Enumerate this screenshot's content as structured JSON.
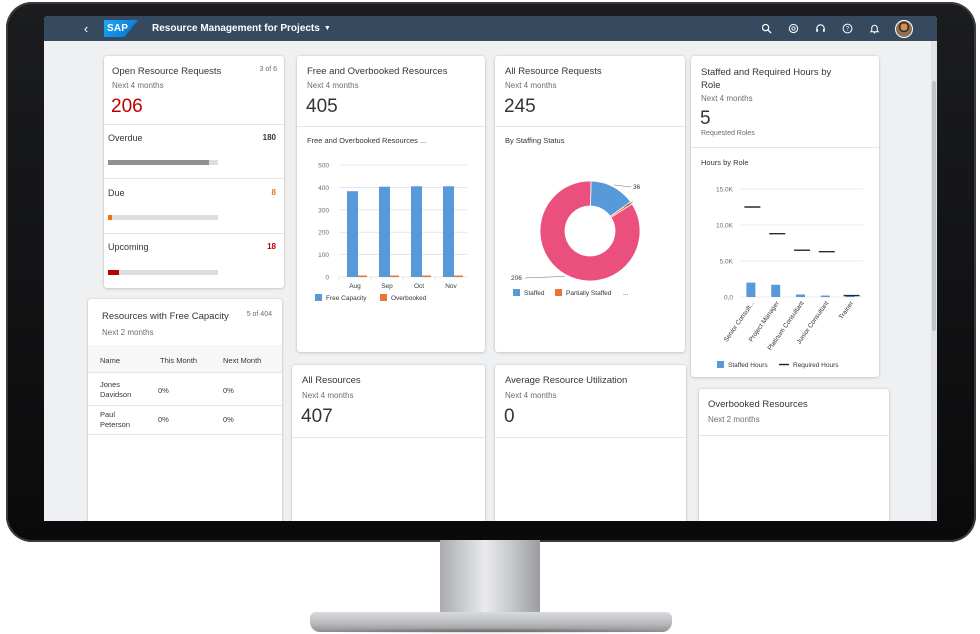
{
  "shell": {
    "back_icon": "chevron-left-icon",
    "logo": "SAP",
    "title": "Resource Management for Projects",
    "icons": [
      "search-icon",
      "copilot-icon",
      "headset-icon",
      "help-icon",
      "bell-icon"
    ]
  },
  "cards": {
    "open_requests": {
      "title": "Open Resource Requests",
      "count": "3 of 6",
      "subtitle": "Next 4 months",
      "value": "206",
      "items": [
        {
          "label": "Overdue",
          "value": "180",
          "fraction": 0.92,
          "color": "#8c9093",
          "value_color": "#32363a"
        },
        {
          "label": "Due",
          "value": "8",
          "fraction": 0.04,
          "color": "#e9730c",
          "value_color": "#e9730c"
        },
        {
          "label": "Upcoming",
          "value": "18",
          "fraction": 0.1,
          "color": "#bb0000",
          "value_color": "#bb0000"
        }
      ]
    },
    "free_capacity": {
      "title": "Resources with Free Capacity",
      "count": "5 of 404",
      "subtitle": "Next 2 months",
      "columns": [
        "Name",
        "This Month",
        "Next Month"
      ],
      "rows": [
        {
          "name": "Jones\nDavidson",
          "this_month": "0%",
          "next_month": "0%"
        },
        {
          "name": "Paul\nPeterson",
          "this_month": "0%",
          "next_month": "0%"
        }
      ]
    },
    "free_overbooked": {
      "title": "Free and Overbooked Resources",
      "subtitle": "Next 4 months",
      "value": "405",
      "chart_title": "Free and Overbooked Resources ..."
    },
    "all_requests": {
      "title": "All Resource Requests",
      "subtitle": "Next 4 months",
      "value": "245",
      "chart_title": "By Staffing Status"
    },
    "staffed_required": {
      "title": "Staffed and Required Hours by Role",
      "subtitle": "Next 4 months",
      "value": "5",
      "value_label": "Requested Roles",
      "chart_title": "Hours by Role"
    },
    "all_resources": {
      "title": "All Resources",
      "subtitle": "Next 4 months",
      "value": "407"
    },
    "utilization": {
      "title": "Average Resource Utilization",
      "subtitle": "Next 4 months",
      "value": "0"
    },
    "overbooked": {
      "title": "Overbooked Resources",
      "subtitle": "Next 2 months"
    }
  },
  "chart_data": [
    {
      "type": "bar",
      "categories": [
        "Aug",
        "Sep",
        "Oct",
        "Nov"
      ],
      "series": [
        {
          "name": "Free Capacity",
          "values": [
            383,
            403,
            405,
            405
          ],
          "color": "#5899da"
        },
        {
          "name": "Overbooked",
          "values": [
            2,
            2,
            2,
            2
          ],
          "color": "#e8743b"
        }
      ],
      "ylim": [
        0,
        500
      ],
      "yticks": [
        "0",
        "100",
        "200",
        "300",
        "400",
        "500"
      ],
      "legend": "bottom"
    },
    {
      "type": "pie",
      "donut": true,
      "labels": [
        "Staffed",
        "Partially Staffed",
        "..."
      ],
      "values": [
        36,
        2,
        206
      ],
      "data_labels": [
        "36",
        "2",
        "206"
      ],
      "colors": [
        "#5899da",
        "#e8743b",
        "#ea4f7e"
      ],
      "legend": "bottom"
    },
    {
      "type": "bar",
      "categories": [
        "Senior Consult...",
        "Project Manager",
        "Platinum Consultant",
        "Junior Consultant",
        "Trainer"
      ],
      "series": [
        {
          "name": "Staffed Hours",
          "values": [
            2000,
            1700,
            350,
            200,
            150
          ],
          "color": "#5899da"
        },
        {
          "name": "Required Hours",
          "values": [
            12500,
            8800,
            6500,
            6300,
            200
          ],
          "color": "#1d2d3e"
        }
      ],
      "ylim": [
        0,
        15000
      ],
      "yticks": [
        "0,0",
        "5,0K",
        "10,0K",
        "15,0K"
      ],
      "legend": "bottom"
    }
  ]
}
